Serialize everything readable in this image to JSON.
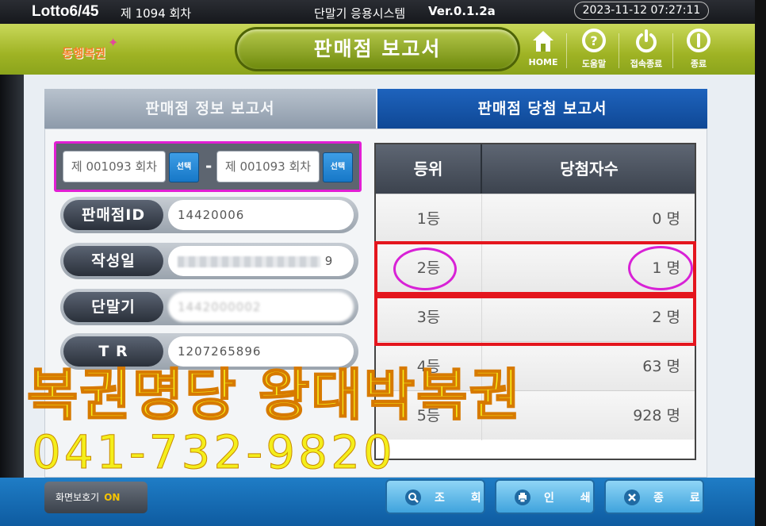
{
  "statusbar": {
    "game": "Lotto6/45",
    "round": "제 1094 회차",
    "system": "단말기 응용시스템",
    "version": "Ver.0.1.2a",
    "datetime": "2023-11-12  07:27:11"
  },
  "header": {
    "logo_text": "동행복권",
    "title": "판매점 보고서",
    "buttons": {
      "home": "HOME",
      "help": "도움말",
      "disconnect": "접속종료",
      "exit": "종료"
    }
  },
  "tabs": {
    "info": "판매점 정보 보고서",
    "winning": "판매점 당첨 보고서"
  },
  "round_range": {
    "from": "제 001093 회차",
    "to": "제 001093 회차",
    "select_label": "선택",
    "separator": "-"
  },
  "info": {
    "store_id": {
      "label": "판매점ID",
      "value": "14420006"
    },
    "created": {
      "label": "작성일",
      "value": "9"
    },
    "terminal": {
      "label": "단말기",
      "value": "1442000002"
    },
    "tr": {
      "label": "T  R",
      "value": "1207265896"
    }
  },
  "table": {
    "headers": [
      "등위",
      "당첨자수"
    ],
    "rows": [
      {
        "rank": "1등",
        "count": "0 명"
      },
      {
        "rank": "2등",
        "count": "1 명"
      },
      {
        "rank": "3등",
        "count": "2 명"
      },
      {
        "rank": "4등",
        "count": "63 명"
      },
      {
        "rank": "5등",
        "count": "928 명"
      }
    ]
  },
  "bottom": {
    "screensaver": "화면보호기",
    "screensaver_state": "ON",
    "query": "조 회",
    "print": "인 쇄",
    "exit": "종 료"
  },
  "overlay": {
    "store_name": "복권명당 왕대박복권",
    "phone": "041-732-9820"
  },
  "colors": {
    "header_green": "#9fb324",
    "active_tab": "#1e63bd",
    "highlight_red": "#e4161e",
    "highlight_magenta": "#d821d6",
    "promo_yellow": "#f4ee1b"
  }
}
